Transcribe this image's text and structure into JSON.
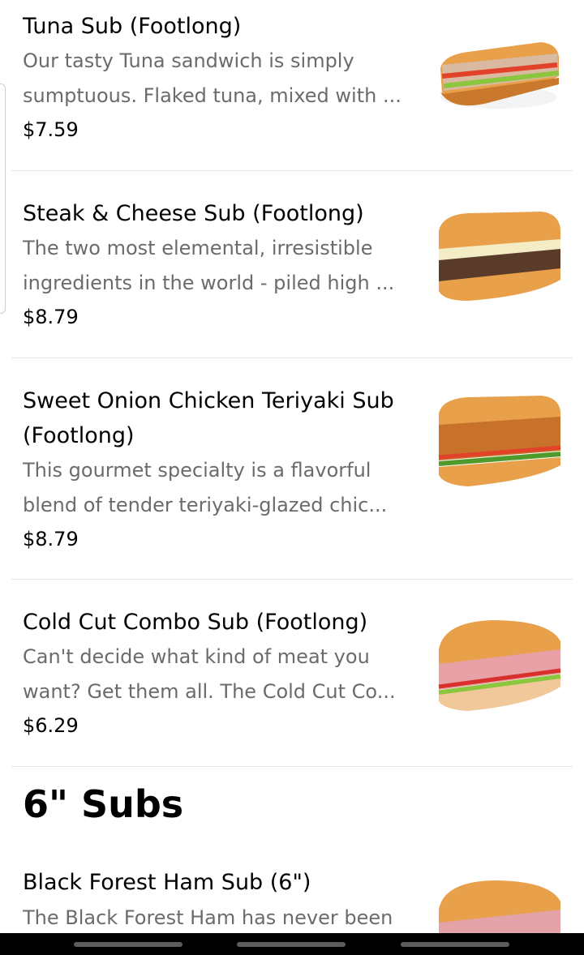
{
  "items": [
    {
      "title": "Tuna Sub (Footlong)",
      "desc1": "Our tasty Tuna sandwich is simply",
      "desc2": "sumptuous. Flaked tuna, mixed with ...",
      "price": "$7.59",
      "filling": "#d9b9a0",
      "accent": "#e2412a"
    },
    {
      "title": "Steak & Cheese Sub (Footlong)",
      "desc1": "The two most elemental, irresistible",
      "desc2": "ingredients in the world - piled high ...",
      "price": "$8.79",
      "filling": "#5a3a28",
      "accent": "#f3ecc4"
    },
    {
      "title1": "Sweet Onion Chicken Teriyaki Sub",
      "title2": "(Footlong)",
      "desc1": "This gourmet specialty is a flavorful",
      "desc2": "blend of tender teriyaki-glazed chic...",
      "price": "$8.79",
      "filling": "#c8712a",
      "accent": "#4e9a2b"
    },
    {
      "title": "Cold Cut Combo Sub (Footlong)",
      "desc1": "Can't decide what kind of meat you",
      "desc2": "want? Get them all. The Cold Cut Co...",
      "price": "$6.29",
      "filling": "#e8a1a6",
      "accent": "#d8302a"
    }
  ],
  "section": {
    "title": "6\" Subs"
  },
  "partial_item": {
    "title": "Black Forest Ham Sub (6\")",
    "desc1": "The Black Forest Ham has never been",
    "filling": "#e4a3a8",
    "accent": "#4e9a2b"
  },
  "colors": {
    "bread": "#e8a04a",
    "bread_dark": "#c9782c",
    "lettuce": "#8cc63f"
  }
}
